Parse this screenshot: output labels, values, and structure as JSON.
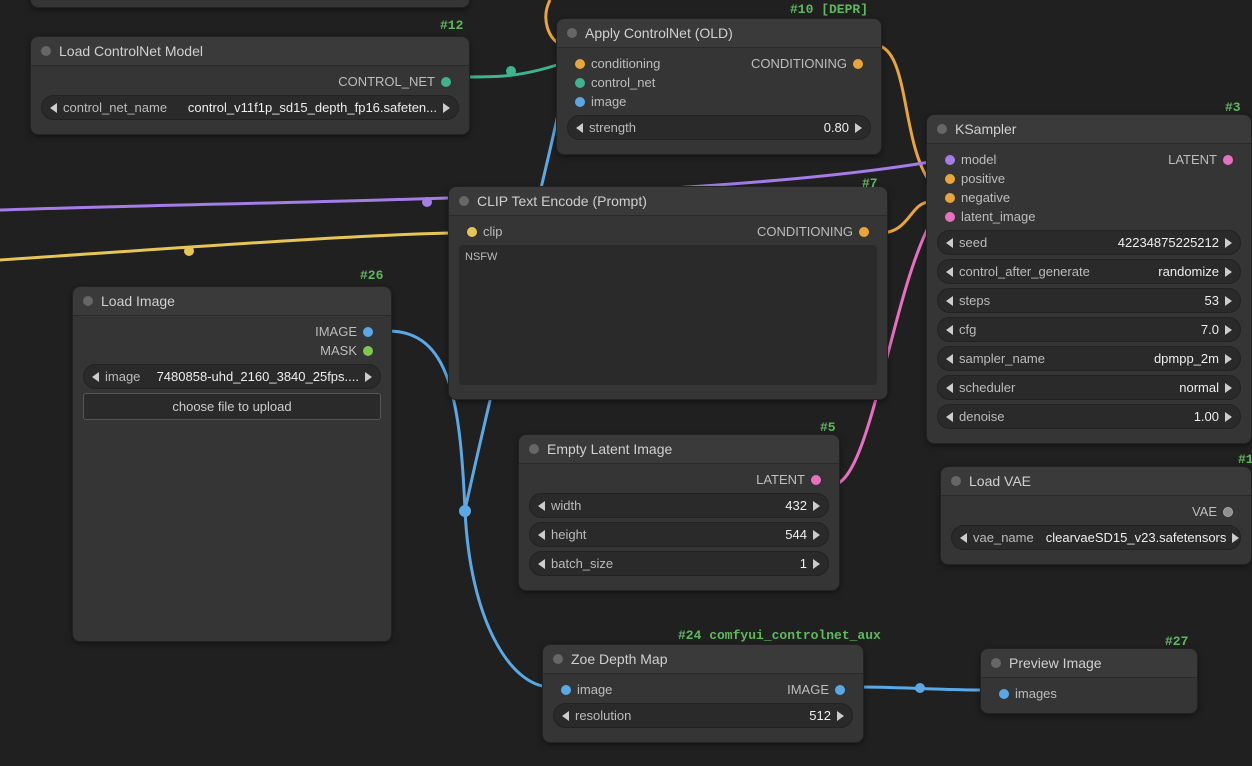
{
  "tags": {
    "n12": "#12",
    "n10": "#10 [DEPR]",
    "n3": "#3",
    "n7": "#7",
    "n26": "#26",
    "n5": "#5",
    "n1": "#1",
    "n24": "#24 comfyui_controlnet_aux",
    "n27": "#27"
  },
  "nodes": {
    "load_controlnet": {
      "title": "Load ControlNet Model",
      "output": "CONTROL_NET",
      "widget_label": "control_net_name",
      "widget_value": "control_v11f1p_sd15_depth_fp16.safeten..."
    },
    "apply_controlnet": {
      "title": "Apply ControlNet (OLD)",
      "inputs": [
        "conditioning",
        "control_net",
        "image"
      ],
      "output": "CONDITIONING",
      "strength_label": "strength",
      "strength_value": "0.80"
    },
    "ksampler": {
      "title": "KSampler",
      "inputs": [
        "model",
        "positive",
        "negative",
        "latent_image"
      ],
      "output": "LATENT",
      "widgets": [
        {
          "label": "seed",
          "value": "42234875225212"
        },
        {
          "label": "control_after_generate",
          "value": "randomize"
        },
        {
          "label": "steps",
          "value": "53"
        },
        {
          "label": "cfg",
          "value": "7.0"
        },
        {
          "label": "sampler_name",
          "value": "dpmpp_2m"
        },
        {
          "label": "scheduler",
          "value": "normal"
        },
        {
          "label": "denoise",
          "value": "1.00"
        }
      ]
    },
    "clip_encode": {
      "title": "CLIP Text Encode (Prompt)",
      "input": "clip",
      "output": "CONDITIONING",
      "text": "NSFW"
    },
    "load_image": {
      "title": "Load Image",
      "outputs": [
        "IMAGE",
        "MASK"
      ],
      "widget_label": "image",
      "widget_value": "7480858-uhd_2160_3840_25fps....",
      "button": "choose file to upload"
    },
    "empty_latent": {
      "title": "Empty Latent Image",
      "output": "LATENT",
      "widgets": [
        {
          "label": "width",
          "value": "432"
        },
        {
          "label": "height",
          "value": "544"
        },
        {
          "label": "batch_size",
          "value": "1"
        }
      ]
    },
    "load_vae": {
      "title": "Load VAE",
      "output": "VAE",
      "widget_label": "vae_name",
      "widget_value": "clearvaeSD15_v23.safetensors"
    },
    "zoe_depth": {
      "title": "Zoe Depth Map",
      "input": "image",
      "output": "IMAGE",
      "widget_label": "resolution",
      "widget_value": "512"
    },
    "preview_image": {
      "title": "Preview Image",
      "input": "images"
    }
  }
}
